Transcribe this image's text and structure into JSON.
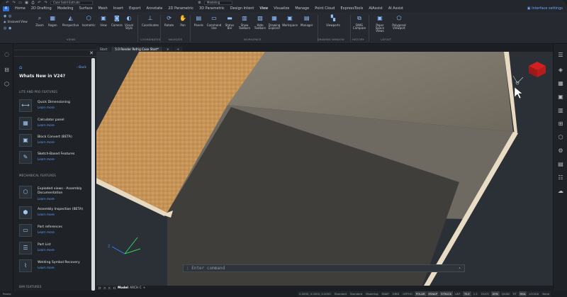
{
  "titlebar": {
    "document_field": "Case Solid Extrude",
    "workspace_field": "Modeling"
  },
  "tabs": [
    "Home",
    "2D Drafting",
    "Modeling",
    "Surface",
    "Mesh",
    "Insert",
    "Export",
    "Annotate",
    "2D Parametric",
    "3D Parametric",
    "Design Intent",
    "View",
    "Visualize",
    "Manage",
    "Point Cloud",
    "ExpressTools",
    "AIAssist",
    "AI Assist"
  ],
  "active_tab": "View",
  "app_button": "A",
  "interface_settings": "Interface settings",
  "ribbon": {
    "unsaved_view": "Unsaved View",
    "buttons": {
      "zoom": "Zoom",
      "regen": "Regen",
      "perspective": "Perspective",
      "isometric": "Isometric",
      "view": "View",
      "camera": "Camera",
      "visual_style": "Visual Style",
      "coordinates": "Coordinates",
      "rotate": "Rotate",
      "pan": "Pan",
      "panels": "Panels",
      "command_line": "Command line",
      "status_bar": "Status Bar",
      "show_toolbars": "Show Toolbars",
      "hide_toolbars": "Hide Toolbars",
      "drawing_explorer": "Drawing Explorer",
      "workspace": "Workspace",
      "manager": "Manager",
      "viewports": "Viewports",
      "dwg_compare": "DWG Compare",
      "paper_space_views": "Paper Space Views",
      "polygonal_viewport": "Polygonal Viewport"
    },
    "groups": {
      "views": "VIEWS",
      "coordinates": "COORDINATES",
      "navigate": "NAVIGATE",
      "workspace": "WORKSPACE",
      "drawing_window": "DRAWING WINDOW",
      "history": "HISTORY",
      "layout": "LAYOUT"
    }
  },
  "panel": {
    "back": "Back",
    "title": "Whats New in V24?",
    "sections": [
      {
        "title": "LITE AND PRO FEATURES",
        "items": [
          {
            "name": "Quick Dimensioning",
            "link": "Learn more",
            "icon": "dimension-icon"
          },
          {
            "name": "Calculator panel",
            "link": "Learn more",
            "icon": "calculator-icon"
          },
          {
            "name": "Block Convert (BETA)",
            "link": "Learn more",
            "icon": "block-icon"
          },
          {
            "name": "Sketch-Based Features",
            "link": "Learn more",
            "icon": "sketch-icon"
          }
        ]
      },
      {
        "title": "MECHANICAL FEATURES",
        "items": [
          {
            "name": "Exploded views - Assembly Documentation",
            "link": "Learn more",
            "icon": "explode-icon"
          },
          {
            "name": "Assembly Inspection (BETA)",
            "link": "Learn more",
            "icon": "assembly-icon"
          },
          {
            "name": "Part references",
            "link": "Learn more",
            "icon": "part-icon"
          },
          {
            "name": "Part List",
            "link": "Learn more",
            "icon": "list-icon"
          },
          {
            "name": "Welding Symbol Recovery",
            "link": "Learn more",
            "icon": "weld-icon"
          }
        ]
      },
      {
        "title": "BIM FEATURES",
        "items": []
      }
    ]
  },
  "doc_tabs": [
    "Start",
    "5.0 Render Refrig Case Start*"
  ],
  "command_placeholder": ": Enter command",
  "layout_tabs": {
    "model": "Model",
    "layout": "ARCH C"
  },
  "status": {
    "left": "Ready",
    "coords": "0.0000, 0.0000, 0.0000",
    "items": [
      "Standard",
      "Standard",
      "Modeling",
      "SNAP",
      "GRID",
      "ORTHO",
      "POLAR",
      "ESNAP",
      "STRACK",
      "LWT",
      "TILE",
      "1:1",
      "DUCS",
      "DYN",
      "QUAD",
      "RT",
      "HKA",
      "LOCKUI",
      "None"
    ],
    "on_items": [
      "POLAR",
      "ESNAP",
      "STRACK",
      "TILE",
      "DYN",
      "HKA"
    ]
  },
  "colors": {
    "accent": "#5ea0ff",
    "wood": "#c9965a",
    "surface": "#7b7467",
    "dark_panel": "#3d3c3b"
  }
}
